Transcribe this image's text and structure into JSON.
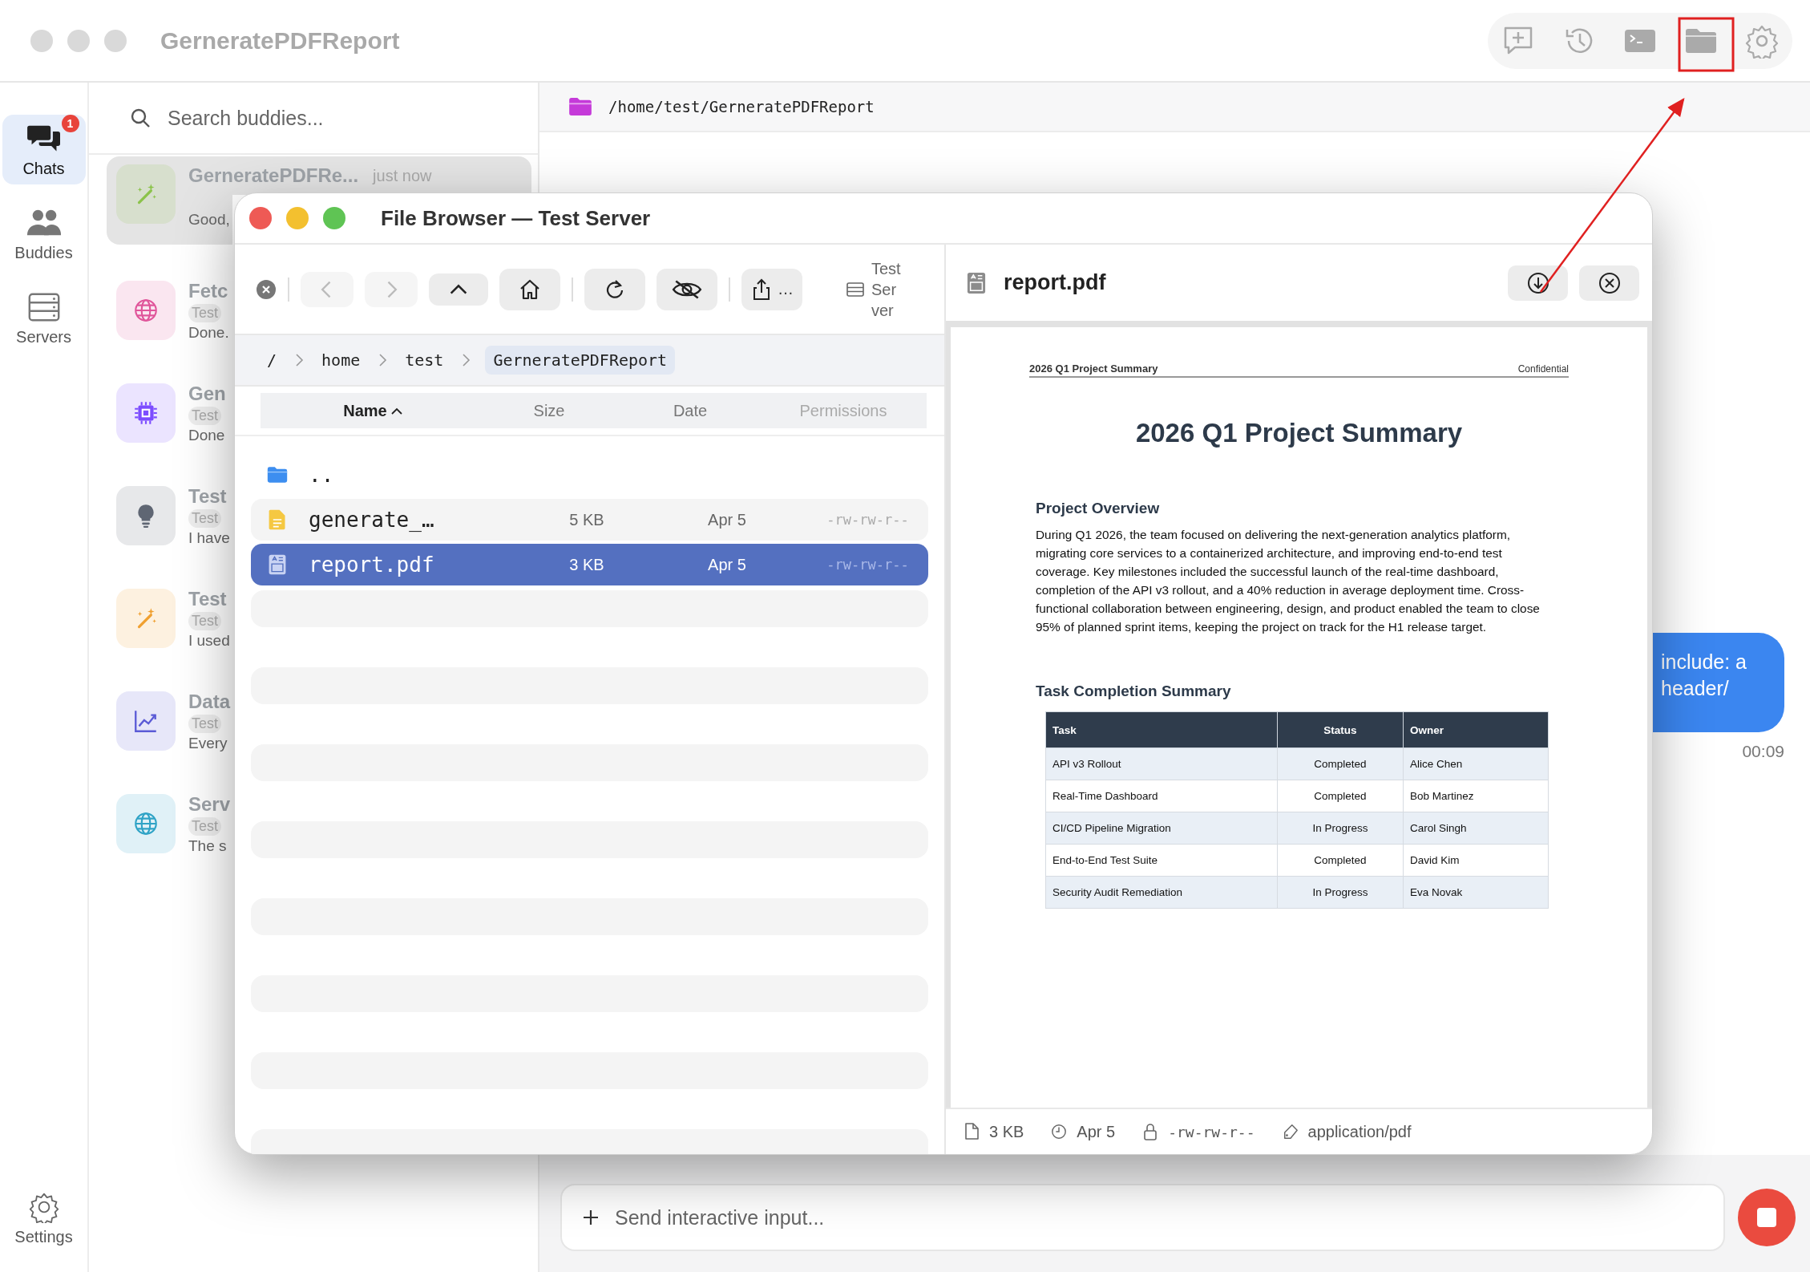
{
  "app": {
    "title": "GerneratePDFReport"
  },
  "nav": [
    {
      "kind": "chats",
      "label": "Chats",
      "selected": true,
      "badge": "1"
    },
    {
      "kind": "buddies",
      "label": "Buddies",
      "selected": false
    },
    {
      "kind": "servers",
      "label": "Servers",
      "selected": false
    }
  ],
  "nav_footer": {
    "label": "Settings"
  },
  "search": {
    "placeholder": "Search buddies..."
  },
  "chats": [
    {
      "kind": "wand",
      "color": "#8bc34a",
      "name": "GerneratePDFRe...",
      "time": "just now",
      "preview": "Good,",
      "selected": true
    },
    {
      "kind": "globe",
      "color": "#e0559a",
      "name": "Fetc",
      "tag": "Test",
      "preview": "Done.",
      "selected": false
    },
    {
      "kind": "chip",
      "color": "#7c4dff",
      "name": "Gen",
      "tag": "Test",
      "preview": "Done",
      "selected": false
    },
    {
      "kind": "bulb",
      "color": "#5f6673",
      "name": "Test",
      "tag": "Test",
      "preview": "I have",
      "selected": false
    },
    {
      "kind": "wand",
      "color": "#f0a030",
      "name": "Test",
      "tag": "Test",
      "preview": "I used",
      "selected": false
    },
    {
      "kind": "chart",
      "color": "#5b5bd6",
      "name": "Data",
      "tag": "Test",
      "preview": "Every",
      "selected": false
    },
    {
      "kind": "globe",
      "color": "#2fa3c6",
      "name": "Serv",
      "tag": "Test",
      "preview": "The s",
      "selected": false
    }
  ],
  "path_bar": {
    "path": "/home/test/GerneratePDFReport"
  },
  "message": {
    "lines": [
      "include: a",
      "header/"
    ],
    "time": "00:09"
  },
  "composer": {
    "placeholder": "Send interactive input..."
  },
  "file_browser": {
    "title": "File Browser — Test Server",
    "more": "…",
    "server": "Test Server",
    "breadcrumb": [
      {
        "label": "/",
        "selected": false
      },
      {
        "label": "home",
        "selected": false
      },
      {
        "label": "test",
        "selected": false
      },
      {
        "label": "GerneratePDFReport",
        "selected": true
      }
    ],
    "columns": [
      {
        "label": "Name",
        "sorted": true
      },
      {
        "label": "Size",
        "sorted": false
      },
      {
        "label": "Date",
        "sorted": false
      },
      {
        "label": "Permissions",
        "sorted": false
      }
    ],
    "rows": [
      {
        "kind": "folder",
        "name": "..",
        "selected": false
      },
      {
        "kind": "text",
        "name": "generate_…",
        "size": "5 KB",
        "date": "Apr 5",
        "permissions": "-rw-rw-r--",
        "selected": false
      },
      {
        "kind": "pdf",
        "name": "report.pdf",
        "size": "3 KB",
        "date": "Apr 5",
        "permissions": "-rw-rw-r--",
        "selected": true
      }
    ]
  },
  "preview": {
    "file": "report.pdf",
    "document": {
      "running_header": "2026 Q1 Project Summary",
      "running_note": "Confidential",
      "title": "2026 Q1 Project Summary",
      "overview_heading": "Project Overview",
      "overview": "During Q1 2026, the team focused on delivering the next-generation analytics platform, migrating core services to a containerized architecture, and improving end-to-end test coverage. Key milestones included the successful launch of the real-time dashboard, completion of the API v3 rollout, and a 40% reduction in average deployment time. Cross-functional collaboration between engineering, design, and product enabled the team to close 95% of planned sprint items, keeping the project on track for the H1 release target.",
      "table_heading": "Task Completion Summary",
      "table": {
        "columns": [
          "Task",
          "Status",
          "Owner"
        ],
        "rows": [
          [
            "API v3 Rollout",
            "Completed",
            "Alice Chen"
          ],
          [
            "Real-Time Dashboard",
            "Completed",
            "Bob Martinez"
          ],
          [
            "CI/CD Pipeline Migration",
            "In Progress",
            "Carol Singh"
          ],
          [
            "End-to-End Test Suite",
            "Completed",
            "David Kim"
          ],
          [
            "Security Audit Remediation",
            "In Progress",
            "Eva Novak"
          ]
        ]
      }
    },
    "status": {
      "size": "3 KB",
      "date": "Apr 5",
      "permissions": "-rw-rw-r--",
      "type": "application/pdf"
    }
  }
}
